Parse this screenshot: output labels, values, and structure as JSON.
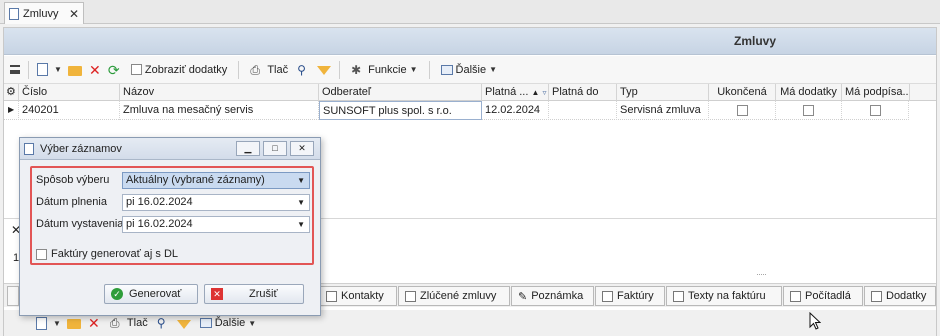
{
  "doc_tab": {
    "label": "Zmluvy",
    "close": "✕"
  },
  "header": {
    "title": "Zmluvy"
  },
  "toolbar": {
    "show_addenda": "Zobraziť dodatky",
    "print": "Tlač",
    "functions": "Funkcie",
    "more": "Ďalšie"
  },
  "grid": {
    "columns": [
      "Číslo",
      "Názov",
      "Odberateľ",
      "Platná ...",
      "Platná do",
      "Typ",
      "Ukončená",
      "Má dodatky",
      "Má podpísa..."
    ],
    "row": {
      "cislo": "240201",
      "nazov": "Zmluva na mesačný servis",
      "odberatel": "SUNSOFT plus spol. s r.o.",
      "platna_od": "12.02.2024",
      "platna_do": "",
      "typ": "Servisná zmluva"
    }
  },
  "bottom_tabs": [
    "Kontakty",
    "Zlúčené zmluvy",
    "Poznámka",
    "Faktúry",
    "Texty na faktúru",
    "Počítadlá",
    "Dodatky"
  ],
  "toolbar2": {
    "print": "Tlač",
    "more": "Ďalšie"
  },
  "dialog": {
    "title": "Výber záznamov",
    "fields": {
      "sposob_label": "Spôsob výberu",
      "sposob_value": "Aktuálny (vybrané záznamy)",
      "datum_plnenia_label": "Dátum plnenia",
      "datum_plnenia_value": "pi 16.02.2024",
      "datum_vystavenia_label": "Dátum vystavenia",
      "datum_vystavenia_value": "pi 16.02.2024",
      "checkbox_label": "Faktúry generovať aj s DL"
    },
    "generate_button": "Generovať",
    "cancel_button": "Zrušiť"
  },
  "misc": {
    "lower_number": "1",
    "lower_x": "✕"
  },
  "colors": {
    "header": "#c7d4e4",
    "highlight": "#e25555"
  }
}
